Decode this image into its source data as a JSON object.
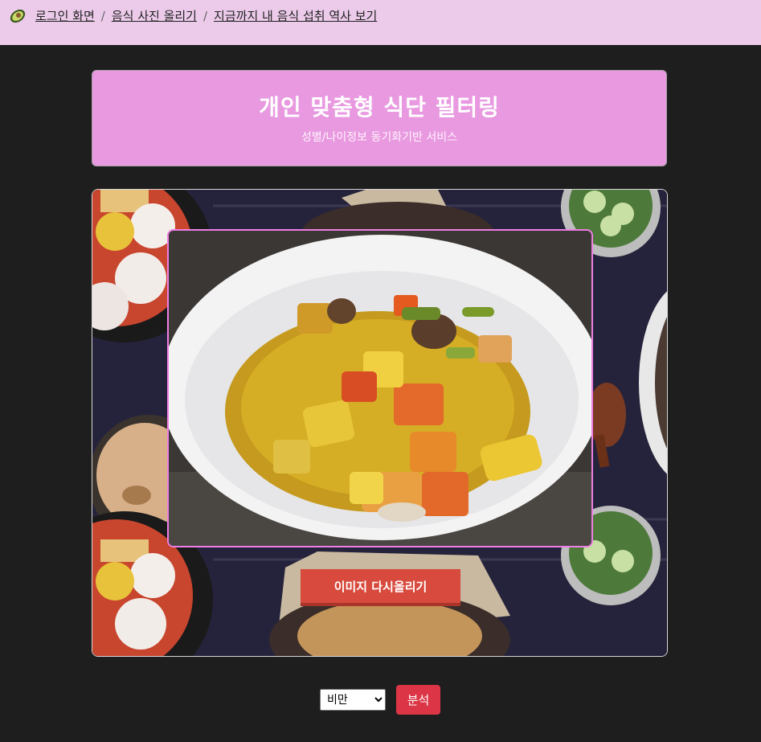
{
  "nav": {
    "logo_icon": "avocado-icon",
    "links": [
      {
        "label": "로그인 화면"
      },
      {
        "label": "음식 사진 올리기"
      },
      {
        "label": "지금까지 내 음식 섭취 역사 보기"
      }
    ],
    "separator": "/"
  },
  "banner": {
    "title": "개인 맞춤형 식단 필터링",
    "subtitle": "성별/나이정보 동기화기반 서비스"
  },
  "upload": {
    "reupload_label": "이미지 다시올리기"
  },
  "analysis": {
    "selected_option": "비만",
    "button_label": "분석"
  },
  "colors": {
    "topbar": "#eccbea",
    "banner": "#e899e0",
    "accent_border": "#ee7fe6",
    "reupload_button": "#d84a3d",
    "analyze_button": "#dc3545",
    "page_background": "#1e1e1e"
  }
}
